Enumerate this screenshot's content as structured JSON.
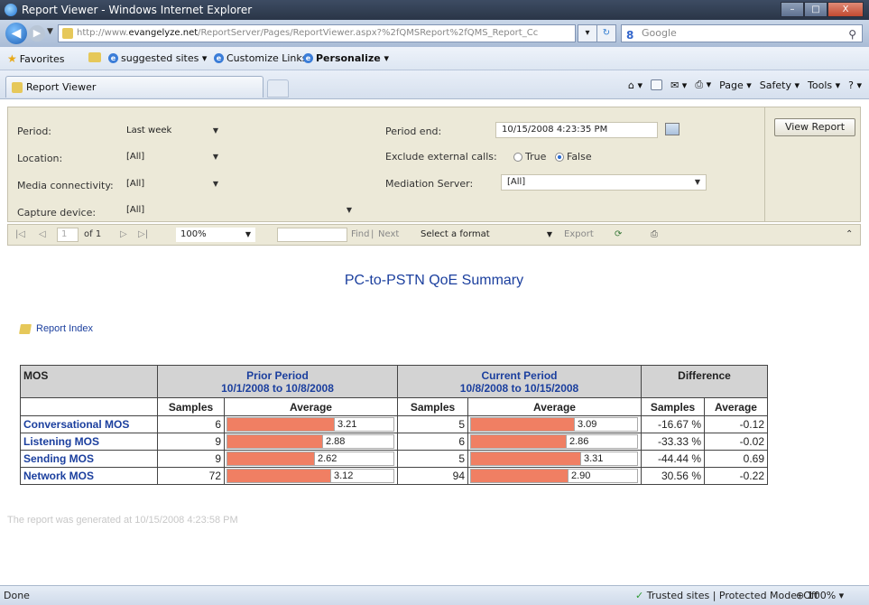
{
  "window": {
    "title": "Report Viewer - Windows Internet Explorer",
    "minimize": "–",
    "maximize": "□",
    "close": "X"
  },
  "address": {
    "url_prefix": "http://www.",
    "url_host": "evangelyze.net",
    "url_rest": "/ReportServer/Pages/ReportViewer.aspx?%2fQMSReport%2fQMS_Report_Cc",
    "search_provider": "Google"
  },
  "favorites": {
    "favorites_label": "Favorites",
    "suggested_label": "suggested sites ▾",
    "customize_label": "Customize Links",
    "personalize_label": "Personalize ▾"
  },
  "tab": {
    "label": "Report Viewer"
  },
  "commandbar": {
    "page": "Page ▾",
    "safety": "Safety ▾",
    "tools": "Tools ▾"
  },
  "params": {
    "period_label": "Period:",
    "period_value": "Last week",
    "location_label": "Location:",
    "location_value": "[All]",
    "media_label": "Media connectivity:",
    "media_value": "[All]",
    "capture_label": "Capture device:",
    "capture_value": "[All]",
    "period_end_label": "Period end:",
    "period_end_value": "10/15/2008 4:23:35 PM",
    "exclude_label": "Exclude external calls:",
    "true_label": "True",
    "false_label": "False",
    "mediation_label": "Mediation Server:",
    "mediation_value": "[All]",
    "view_report": "View Report"
  },
  "report_toolbar": {
    "first": "|◁",
    "prev": "◁",
    "page_value": "1",
    "of_label": "of 1",
    "next": "▷",
    "last": "▷|",
    "zoom": "100%",
    "find": "Find",
    "sep": "|",
    "next_label": "Next",
    "format": "Select a format",
    "export": "Export"
  },
  "report": {
    "title": "PC-to-PSTN QoE Summary",
    "index_link": "Report Index",
    "generated": "The report was generated at 10/15/2008 4:23:58 PM",
    "headers": {
      "mos": "MOS",
      "prior_title": "Prior Period",
      "prior_range": "10/1/2008 to 10/8/2008",
      "current_title": "Current Period",
      "current_range": "10/8/2008 to 10/15/2008",
      "difference": "Difference",
      "samples": "Samples",
      "average": "Average"
    },
    "rows": [
      {
        "label": "Conversational MOS",
        "prior_samples": "6",
        "prior_avg": "3.21",
        "prior_fill": 0.64,
        "cur_samples": "5",
        "cur_avg": "3.09",
        "cur_fill": 0.62,
        "diff_samples": "-16.67 %",
        "diff_avg": "-0.12"
      },
      {
        "label": "Listening MOS",
        "prior_samples": "9",
        "prior_avg": "2.88",
        "prior_fill": 0.57,
        "cur_samples": "6",
        "cur_avg": "2.86",
        "cur_fill": 0.57,
        "diff_samples": "-33.33 %",
        "diff_avg": "-0.02"
      },
      {
        "label": "Sending MOS",
        "prior_samples": "9",
        "prior_avg": "2.62",
        "prior_fill": 0.52,
        "cur_samples": "5",
        "cur_avg": "3.31",
        "cur_fill": 0.66,
        "diff_samples": "-44.44 %",
        "diff_avg": "0.69"
      },
      {
        "label": "Network MOS",
        "prior_samples": "72",
        "prior_avg": "3.12",
        "prior_fill": 0.62,
        "cur_samples": "94",
        "cur_avg": "2.90",
        "cur_fill": 0.58,
        "diff_samples": "30.56 %",
        "diff_avg": "-0.22"
      }
    ]
  },
  "status": {
    "left": "Done",
    "zone": "Trusted sites | Protected Mode: Off",
    "zoom": "100%"
  },
  "colors": {
    "bar": "#f07f63",
    "link": "#1b3f9e",
    "header_bg": "#d3d3d3"
  }
}
